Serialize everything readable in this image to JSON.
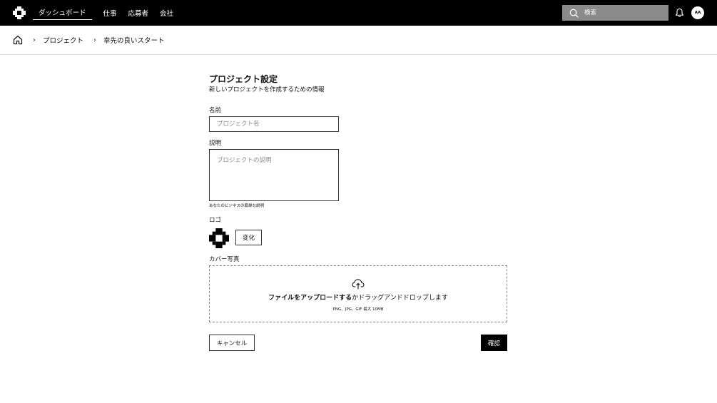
{
  "header": {
    "logo_icon": "checker-logo-icon",
    "nav": [
      "ダッシュボード",
      "仕事",
      "応募者",
      "会社"
    ],
    "active_nav": 0,
    "search_placeholder": "検索",
    "avatar_initials": "AA"
  },
  "breadcrumb": {
    "items": [
      "プロジェクト",
      "幸先の良いスタート"
    ]
  },
  "form": {
    "title": "プロジェクト設定",
    "subtitle": "新しいプロジェクトを作成するための情報",
    "name_label": "名前",
    "name_placeholder": "プロジェクト名",
    "name_value": "",
    "description_label": "説明",
    "description_placeholder": "プロジェクトの説明",
    "description_value": "",
    "description_helper": "あなたのビジネスの簡単な説明",
    "logo_label": "ロゴ",
    "change_label": "変化",
    "cover_label": "カバー写真",
    "upload_bold": "ファイルをアップロードする",
    "upload_rest": "かドラッグアンドドロップします",
    "upload_hint": "PNG、JPG、GIF 最大 10MB",
    "cancel_label": "キャンセル",
    "confirm_label": "確認"
  },
  "colors": {
    "topbar": "#000000",
    "search_bg": "#8a8a8a",
    "primary_button": "#000000"
  }
}
